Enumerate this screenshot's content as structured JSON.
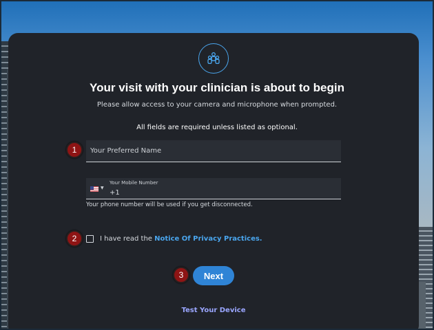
{
  "header": {
    "icon": "people-group-icon",
    "title": "Your visit with your clinician is about to begin",
    "subtitle": "Please allow access to your camera and microphone when prompted."
  },
  "form": {
    "required_note": "All fields are required unless listed as optional.",
    "name_placeholder": "Your Preferred Name",
    "phone": {
      "country_flag": "us-flag-icon",
      "label": "Your Mobile Number",
      "value": "+1",
      "help": "Your phone number will be used if you get disconnected."
    },
    "consent": {
      "prefix": "I have read the",
      "link": "Notice Of Privacy Practices.",
      "checked": false
    },
    "next_label": "Next",
    "test_device_label": "Test Your Device"
  },
  "annotations": {
    "badge1": "1",
    "badge2": "2",
    "badge3": "3"
  },
  "colors": {
    "card_bg": "#202329",
    "accent": "#2f84d6",
    "link": "#4aa6ee",
    "badge": "#8e1414"
  }
}
